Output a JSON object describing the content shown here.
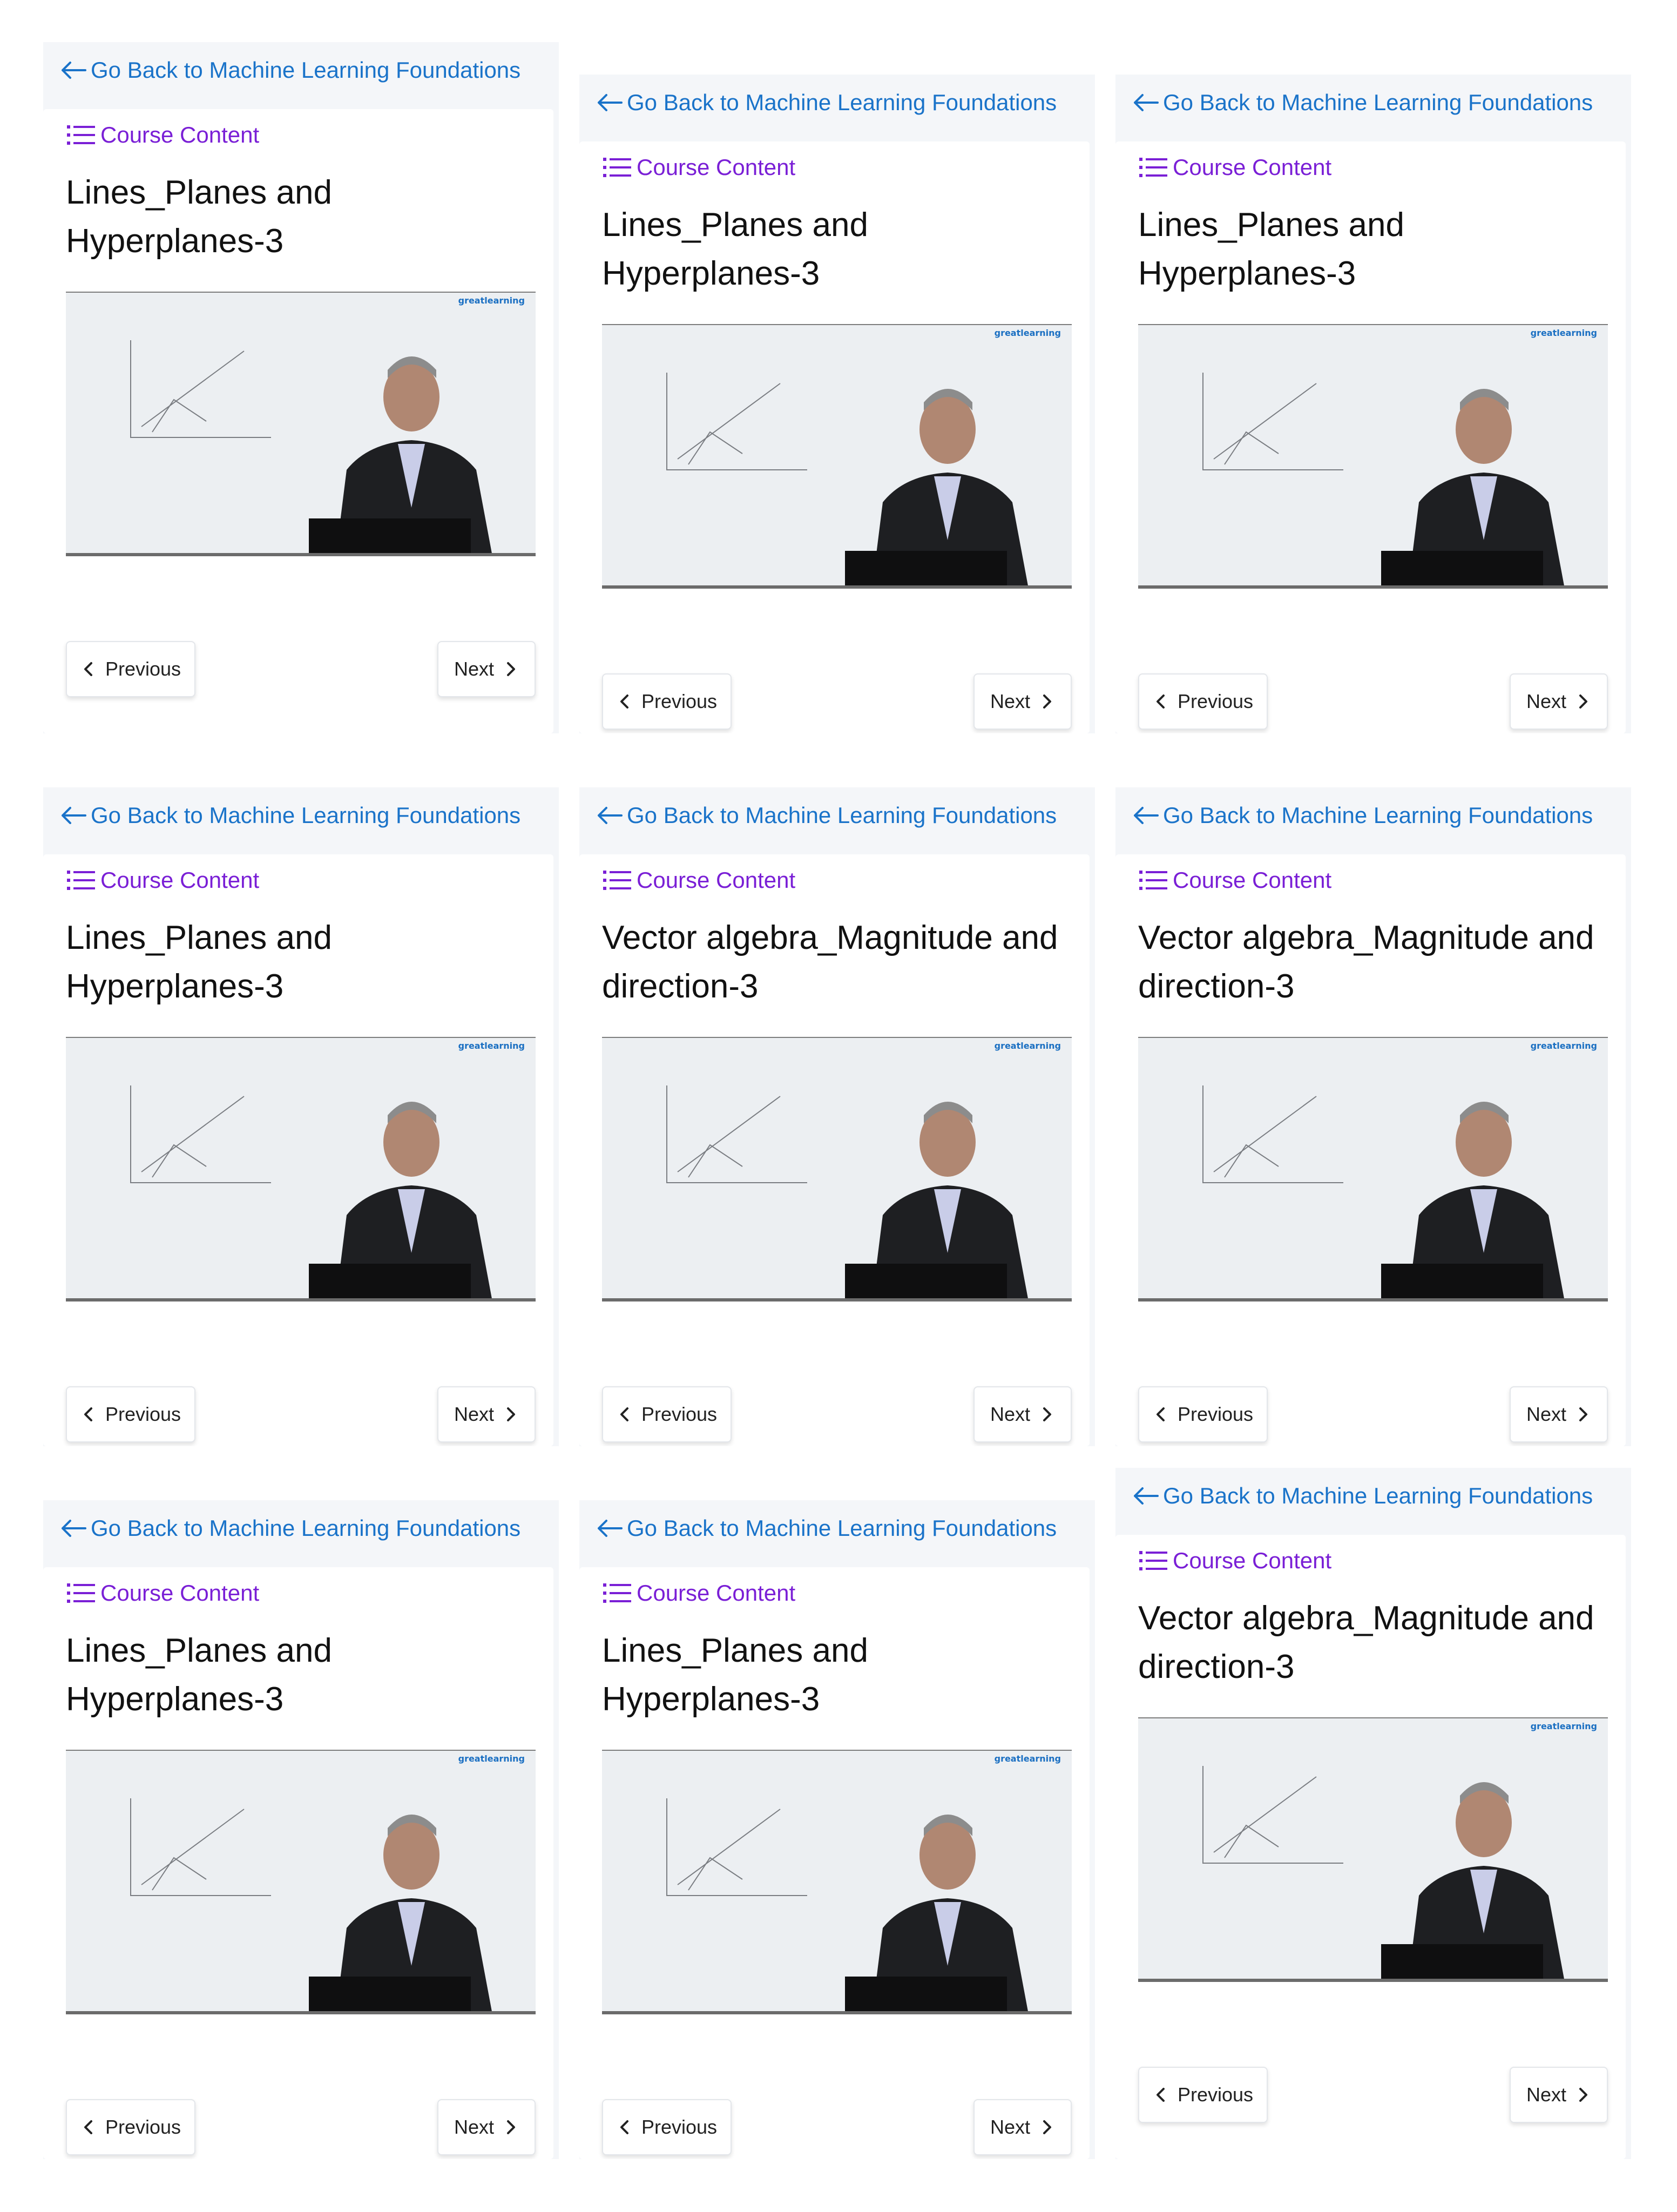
{
  "common": {
    "back_label": "Go Back to Machine Learning Foundations",
    "content_label": "Course Content",
    "prev_label": "Previous",
    "next_label": "Next",
    "video_brand": "greatlearning"
  },
  "colors": {
    "link_blue": "#1a73c9",
    "content_purple": "#7a1fd6",
    "panel_bg": "#f4f6f9",
    "active_toggle_bg": "#d3d8e3"
  },
  "icons": {
    "back": "arrow-left-icon",
    "content": "list-icon",
    "prev": "chevron-left-icon",
    "next": "chevron-right-icon"
  },
  "panels": [
    {
      "title": "Lines_Planes and Hyperplanes-3",
      "content_active": false
    },
    {
      "title": "Lines_Planes and Hyperplanes-3",
      "content_active": false
    },
    {
      "title": "Lines_Planes and Hyperplanes-3",
      "content_active": false
    },
    {
      "title": "Lines_Planes and Hyperplanes-3",
      "content_active": false
    },
    {
      "title": "Vector algebra_Magnitude and direction-3",
      "content_active": true
    },
    {
      "title": "Vector algebra_Magnitude and direction-3",
      "content_active": false
    },
    {
      "title": "Lines_Planes and Hyperplanes-3",
      "content_active": false
    },
    {
      "title": "Lines_Planes and Hyperplanes-3",
      "content_active": false
    },
    {
      "title": "Vector algebra_Magnitude and direction-3",
      "content_active": false
    }
  ]
}
